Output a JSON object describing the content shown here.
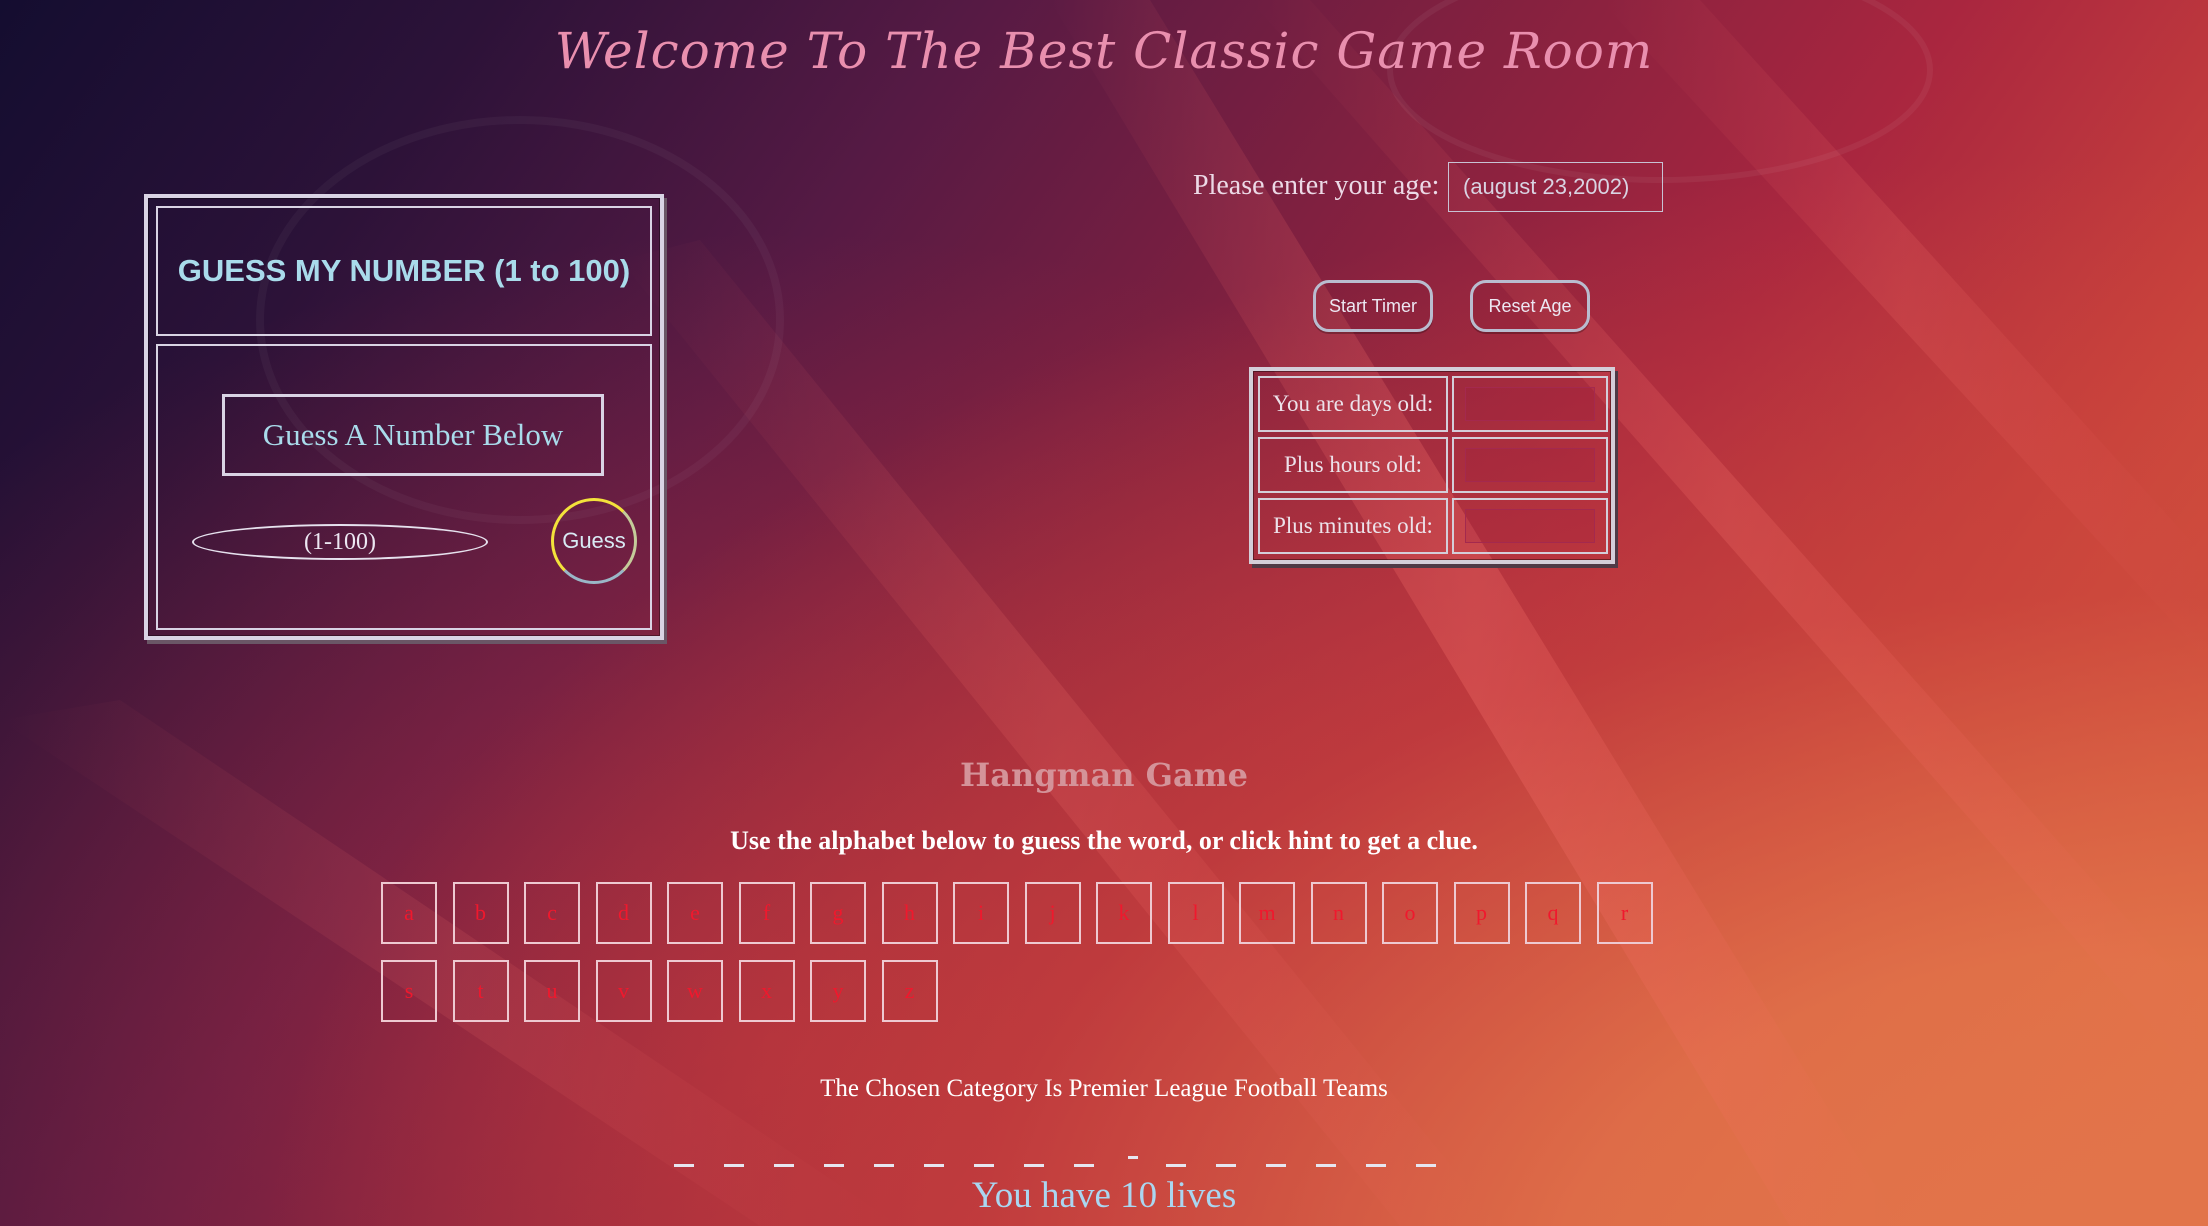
{
  "title": "Welcome To The Best Classic Game Room",
  "guess_game": {
    "heading": "GUESS MY NUMBER (1 to 100)",
    "label": "Guess A Number Below",
    "input_placeholder": "(1-100)",
    "button_label": "Guess"
  },
  "age_calculator": {
    "prompt": "Please enter your age:",
    "input_placeholder": "(august 23,2002)",
    "start_label": "Start Timer",
    "reset_label": "Reset Age",
    "rows": [
      {
        "label": "You are days old:",
        "value": ""
      },
      {
        "label": "Plus hours old:",
        "value": ""
      },
      {
        "label": "Plus minutes old:",
        "value": ""
      }
    ]
  },
  "hangman": {
    "title": "Hangman Game",
    "instructions": "Use the alphabet below to guess the word, or click hint to get a clue.",
    "letters": [
      "a",
      "b",
      "c",
      "d",
      "e",
      "f",
      "g",
      "h",
      "i",
      "j",
      "k",
      "l",
      "m",
      "n",
      "o",
      "p",
      "q",
      "r",
      "s",
      "t",
      "u",
      "v",
      "w",
      "x",
      "y",
      "z"
    ],
    "category": "The Chosen Category Is Premier League Football Teams",
    "word_pattern": [
      "_",
      "_",
      "_",
      "_",
      "_",
      "_",
      "_",
      "_",
      "_",
      "-",
      "_",
      "_",
      "_",
      "_",
      "_",
      "_"
    ],
    "lives": "You have 10 lives"
  },
  "colors": {
    "title": "#e98fae",
    "panel_text": "#a9dbeb",
    "letter": "#f0182d",
    "lives": "#aad6f0"
  }
}
